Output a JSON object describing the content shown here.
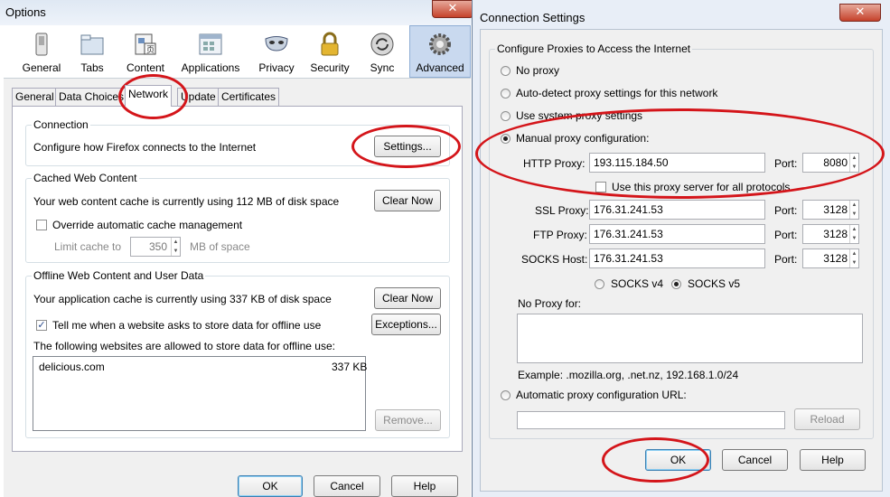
{
  "options": {
    "title": "Options",
    "close_glyph": "✕",
    "toolbar": [
      {
        "label": "General",
        "icon": "switch-icon"
      },
      {
        "label": "Tabs",
        "icon": "folder-icon"
      },
      {
        "label": "Content",
        "icon": "document-icon"
      },
      {
        "label": "Applications",
        "icon": "applications-icon"
      },
      {
        "label": "Privacy",
        "icon": "mask-icon"
      },
      {
        "label": "Security",
        "icon": "lock-icon"
      },
      {
        "label": "Sync",
        "icon": "sync-icon"
      },
      {
        "label": "Advanced",
        "icon": "gear-icon"
      }
    ],
    "subtabs": [
      "General",
      "Data Choices",
      "Network",
      "Update",
      "Certificates"
    ],
    "connection": {
      "heading": "Connection",
      "text": "Configure how Firefox connects to the Internet",
      "button": "Settings..."
    },
    "cache": {
      "heading": "Cached Web Content",
      "text": "Your web content cache is currently using 112 MB of disk space",
      "clear": "Clear Now",
      "override": "Override automatic cache management",
      "limit_label": "Limit cache to",
      "limit_value": "350",
      "limit_unit": "MB of space"
    },
    "offline": {
      "heading": "Offline Web Content and User Data",
      "text": "Your application cache is currently using 337 KB of disk space",
      "clear": "Clear Now",
      "tell": "Tell me when a website asks to store data for offline use",
      "exceptions": "Exceptions...",
      "allowed": "The following websites are allowed to store data for offline use:",
      "sites": [
        {
          "name": "delicious.com",
          "size": "337 KB"
        }
      ],
      "remove": "Remove..."
    },
    "ok": "OK",
    "cancel": "Cancel",
    "help": "Help"
  },
  "conn": {
    "title": "Connection Settings",
    "close_glyph": "✕",
    "group_title": "Configure Proxies to Access the Internet",
    "no_proxy": "No proxy",
    "auto_detect": "Auto-detect proxy settings for this network",
    "system": "Use system proxy settings",
    "manual": "Manual proxy configuration:",
    "http_label": "HTTP Proxy:",
    "http_value": "193.115.184.50",
    "http_port": "8080",
    "port_label": "Port:",
    "use_all": "Use this proxy server for all protocols",
    "ssl_label": "SSL Proxy:",
    "ssl_value": "176.31.241.53",
    "ssl_port": "3128",
    "ftp_label": "FTP Proxy:",
    "ftp_value": "176.31.241.53",
    "ftp_port": "3128",
    "socks_label": "SOCKS Host:",
    "socks_value": "176.31.241.53",
    "socks_port": "3128",
    "socks4": "SOCKS v4",
    "socks5": "SOCKS v5",
    "no_proxy_for": "No Proxy for:",
    "example": "Example: .mozilla.org, .net.nz, 192.168.1.0/24",
    "auto_url": "Automatic proxy configuration URL:",
    "reload": "Reload",
    "ok": "OK",
    "cancel": "Cancel",
    "help": "Help"
  },
  "colors": {
    "annotation": "#d4151a",
    "selected_toolbar": "#c9d9ef"
  }
}
